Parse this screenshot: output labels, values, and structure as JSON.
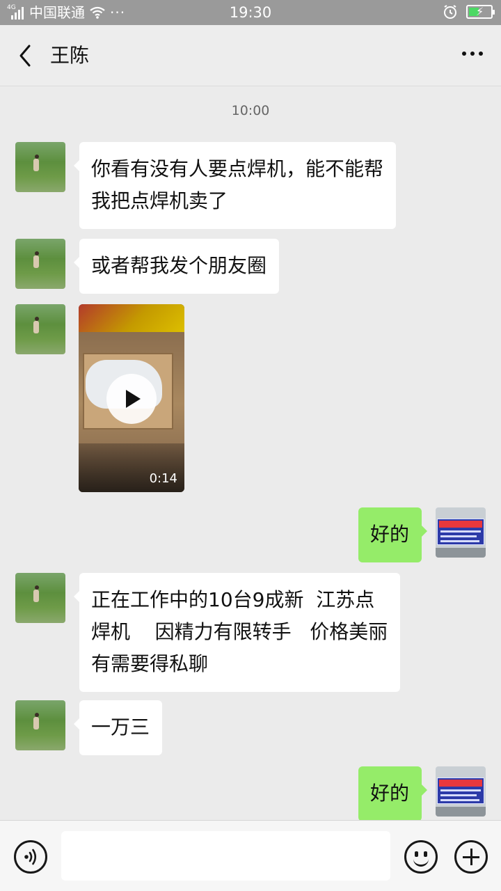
{
  "status_bar": {
    "network": "4G",
    "carrier": "中国联通",
    "more": "···",
    "time": "19:30"
  },
  "header": {
    "title": "王陈"
  },
  "chat": {
    "time_label": "10:00",
    "messages": [
      {
        "side": "left",
        "type": "text",
        "text": "你看有没有人要点焊机，能不能帮\n我把点焊机卖了"
      },
      {
        "side": "left",
        "type": "text",
        "text": "或者帮我发个朋友圈"
      },
      {
        "side": "left",
        "type": "video",
        "duration": "0:14"
      },
      {
        "side": "right",
        "type": "text",
        "text": "好的"
      },
      {
        "side": "left",
        "type": "text",
        "text": "正在工作中的10台9成新  江苏点\n焊机    因精力有限转手   价格美丽\n有需要得私聊"
      },
      {
        "side": "left",
        "type": "text",
        "text": "一万三"
      },
      {
        "side": "right",
        "type": "text",
        "text": "好的"
      }
    ]
  },
  "input_bar": {
    "value": ""
  },
  "colors": {
    "bubble_self": "#95ec69",
    "bubble_other": "#ffffff",
    "background": "#ebebeb"
  }
}
